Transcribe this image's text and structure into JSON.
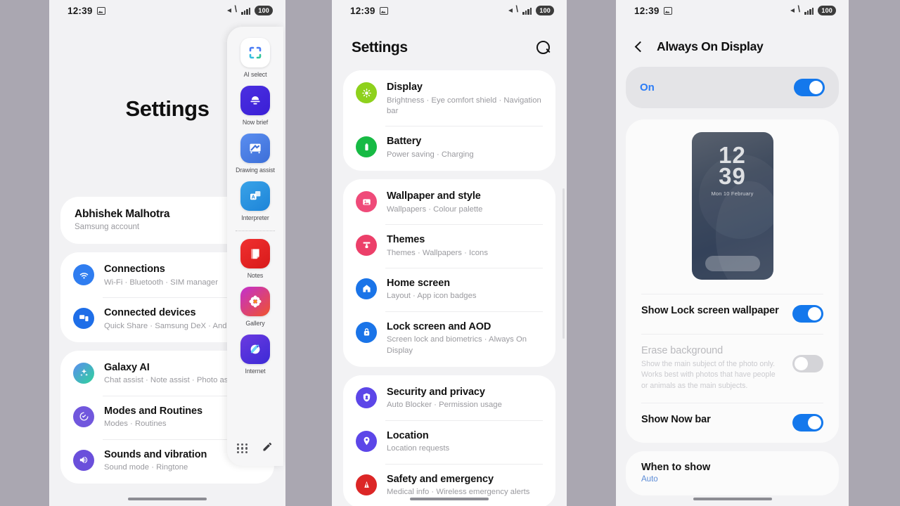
{
  "status_bar": {
    "time": "12:39",
    "battery": "100",
    "icons": [
      "screenshot-icon",
      "mute-icon",
      "signal-icon",
      "battery-icon"
    ]
  },
  "phone1": {
    "title": "Settings",
    "account": {
      "name": "Abhishek Malhotra",
      "subtitle": "Samsung account"
    },
    "groups": [
      {
        "items": [
          {
            "title": "Connections",
            "subtitle": "Wi-Fi  ·  Bluetooth  ·  SIM manager",
            "icon": "wifi-icon",
            "color": "#2f7df0"
          },
          {
            "title": "Connected devices",
            "subtitle": "Quick Share  ·  Samsung DeX  ·  And",
            "icon": "devices-icon",
            "color": "#1e6ee8"
          }
        ]
      },
      {
        "items": [
          {
            "title": "Galaxy AI",
            "subtitle": "Chat assist  ·  Note assist  ·  Photo as",
            "icon": "sparkle-icon",
            "color": "#3aa7d8"
          },
          {
            "title": "Modes and Routines",
            "subtitle": "Modes  ·  Routines",
            "icon": "modes-icon",
            "color": "#7157dd"
          },
          {
            "title": "Sounds and vibration",
            "subtitle": "Sound mode  ·  Ringtone",
            "icon": "volume-icon",
            "color": "#6a4fdb"
          }
        ]
      }
    ],
    "gear_button": "settings-gear-icon",
    "edge_panel": {
      "apps": [
        {
          "label": "AI select",
          "icon": "ai-select-icon"
        },
        {
          "label": "Now brief",
          "icon": "now-brief-icon"
        },
        {
          "label": "Drawing assist",
          "icon": "drawing-assist-icon"
        },
        {
          "label": "Interpreter",
          "icon": "interpreter-icon"
        },
        {
          "label": "Notes",
          "icon": "samsung-notes-icon"
        },
        {
          "label": "Gallery",
          "icon": "gallery-icon"
        },
        {
          "label": "Internet",
          "icon": "samsung-internet-icon"
        }
      ],
      "footer": {
        "apps_grid": "app-grid-icon",
        "edit": "pencil-edit-icon"
      },
      "divider_after_index": 3
    }
  },
  "phone2": {
    "title": "Settings",
    "search_icon": "search-icon",
    "groups": [
      {
        "items": [
          {
            "title": "Display",
            "subtitle": "Brightness  ·  Eye comfort shield  ·  Navigation bar",
            "icon": "display-icon",
            "color": "#8ed11c"
          },
          {
            "title": "Battery",
            "subtitle": "Power saving  ·  Charging",
            "icon": "battery-icon",
            "color": "#17ba44"
          }
        ]
      },
      {
        "items": [
          {
            "title": "Wallpaper and style",
            "subtitle": "Wallpapers  ·  Colour palette",
            "icon": "wallpaper-icon",
            "color": "#ef4a79"
          },
          {
            "title": "Themes",
            "subtitle": "Themes  ·  Wallpapers  ·  Icons",
            "icon": "themes-icon",
            "color": "#ec3f69"
          },
          {
            "title": "Home screen",
            "subtitle": "Layout  ·  App icon badges",
            "icon": "home-icon",
            "color": "#1a74e8"
          },
          {
            "title": "Lock screen and AOD",
            "subtitle": "Screen lock and biometrics  ·  Always On Display",
            "icon": "lock-icon",
            "color": "#1a74e8"
          }
        ]
      },
      {
        "items": [
          {
            "title": "Security and privacy",
            "subtitle": "Auto Blocker  ·  Permission usage",
            "icon": "shield-icon",
            "color": "#5c46e8"
          },
          {
            "title": "Location",
            "subtitle": "Location requests",
            "icon": "location-pin-icon",
            "color": "#5c46e8"
          },
          {
            "title": "Safety and emergency",
            "subtitle": "Medical info  ·  Wireless emergency alerts",
            "icon": "emergency-icon",
            "color": "#dc2626"
          }
        ]
      }
    ]
  },
  "phone3": {
    "back_icon": "back-chevron-icon",
    "title": "Always On Display",
    "master": {
      "label": "On",
      "enabled": true
    },
    "preview": {
      "hours": "12",
      "minutes": "39",
      "date": "Mon 10 February"
    },
    "settings": [
      {
        "title": "Show Lock screen wallpaper",
        "subtitle": "",
        "enabled": true,
        "disabled": false
      },
      {
        "title": "Erase background",
        "subtitle": "Show the main subject of the photo only. Works best with photos that have people or animals as the main subjects.",
        "enabled": false,
        "disabled": true
      },
      {
        "title": "Show Now bar",
        "subtitle": "",
        "enabled": true,
        "disabled": false
      }
    ],
    "when_to_show": {
      "title": "When to show",
      "value": "Auto"
    }
  }
}
